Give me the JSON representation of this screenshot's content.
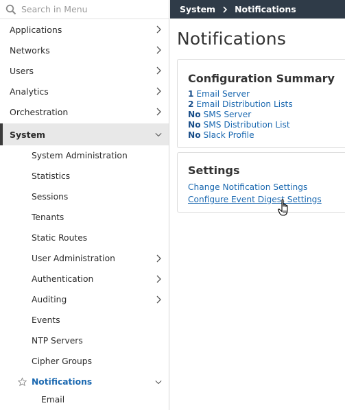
{
  "search": {
    "placeholder": "Search in Menu"
  },
  "sidebar": {
    "items": [
      {
        "label": "Applications"
      },
      {
        "label": "Networks"
      },
      {
        "label": "Users"
      },
      {
        "label": "Analytics"
      },
      {
        "label": "Orchestration"
      },
      {
        "label": "System"
      }
    ],
    "system_subitems": [
      {
        "label": "System Administration"
      },
      {
        "label": "Statistics"
      },
      {
        "label": "Sessions"
      },
      {
        "label": "Tenants"
      },
      {
        "label": "Static Routes"
      },
      {
        "label": "User Administration"
      },
      {
        "label": "Authentication"
      },
      {
        "label": "Auditing"
      },
      {
        "label": "Events"
      },
      {
        "label": "NTP Servers"
      },
      {
        "label": "Cipher Groups"
      },
      {
        "label": "Notifications"
      }
    ],
    "notifications_subitems": [
      {
        "label": "Email"
      }
    ]
  },
  "breadcrumb": {
    "root": "System",
    "current": "Notifications"
  },
  "page": {
    "title": "Notifications"
  },
  "config_summary": {
    "title": "Configuration Summary",
    "rows": [
      {
        "count": "1",
        "label": "Email Server"
      },
      {
        "count": "2",
        "label": "Email Distribution Lists"
      },
      {
        "count": "No",
        "label": "SMS Server"
      },
      {
        "count": "No",
        "label": "SMS Distribution List"
      },
      {
        "count": "No",
        "label": "Slack Profile"
      }
    ]
  },
  "settings": {
    "title": "Settings",
    "links": [
      {
        "label": "Change Notification Settings"
      },
      {
        "label": "Configure Event Digest Settings"
      }
    ]
  },
  "colors": {
    "topbar": "#2f3b48",
    "link": "#1a68b0",
    "active_bg": "#e8e8e8"
  }
}
